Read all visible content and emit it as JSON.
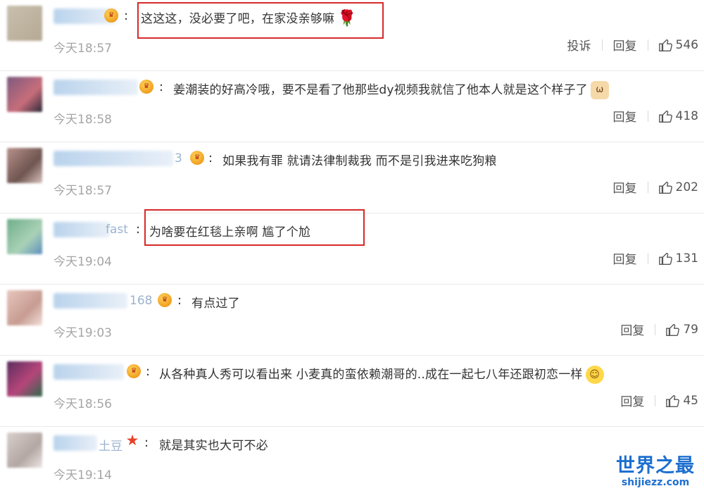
{
  "comments": [
    {
      "name_suffix": "",
      "badge": "",
      "text": "这这这，没必要了吧，在家没亲够嘛",
      "emoji": "rose",
      "time": "今天18:57",
      "report_label": "投诉",
      "reply_label": "回复",
      "likes": "546",
      "highlighted": true
    },
    {
      "name_suffix": "",
      "badge": "crown",
      "text": "姜潮装的好高冷哦，要不是看了他那些dy视频我就信了他本人就是这个样子了",
      "emoji": "cat",
      "time": "今天18:58",
      "reply_label": "回复",
      "likes": "418"
    },
    {
      "name_suffix": "3",
      "badge": "crown",
      "text": "如果我有罪 就请法律制裁我 而不是引我进来吃狗粮",
      "emoji": "",
      "time": "今天18:57",
      "reply_label": "回复",
      "likes": "202"
    },
    {
      "name_suffix": "fast",
      "badge": "",
      "text": "为啥要在红毯上亲啊 尴了个尬",
      "emoji": "",
      "time": "今天19:04",
      "reply_label": "回复",
      "likes": "131",
      "highlighted": true
    },
    {
      "name_suffix": "168",
      "badge": "crown",
      "text": "有点过了",
      "emoji": "",
      "time": "今天19:03",
      "reply_label": "回复",
      "likes": "79"
    },
    {
      "name_suffix": "",
      "badge": "crown",
      "text": "从各种真人秀可以看出来 小麦真的蛮依赖潮哥的..成在一起七八年还跟初恋一样",
      "emoji": "smile",
      "time": "今天18:56",
      "reply_label": "回复",
      "likes": "45"
    },
    {
      "name_suffix": "土豆",
      "badge": "star",
      "text": "就是其实也大可不必",
      "emoji": "",
      "time": "今天19:14",
      "reply_label": "",
      "likes": ""
    }
  ],
  "watermark": {
    "title": "世界之最",
    "url": "shijiezz.com"
  },
  "colors": {
    "highlight_border": "#d62a2a",
    "timestamp": "#a5a5a5",
    "username_blur": "#b9d3ec",
    "watermark": "#1e6fcf"
  },
  "icons": {
    "like": "thumbs-up-icon",
    "badge": "crown-badge-icon",
    "star": "star-badge-icon",
    "rose": "rose-emoji-icon",
    "cat": "cat-emoji-icon",
    "smile": "smile-emoji-icon"
  }
}
